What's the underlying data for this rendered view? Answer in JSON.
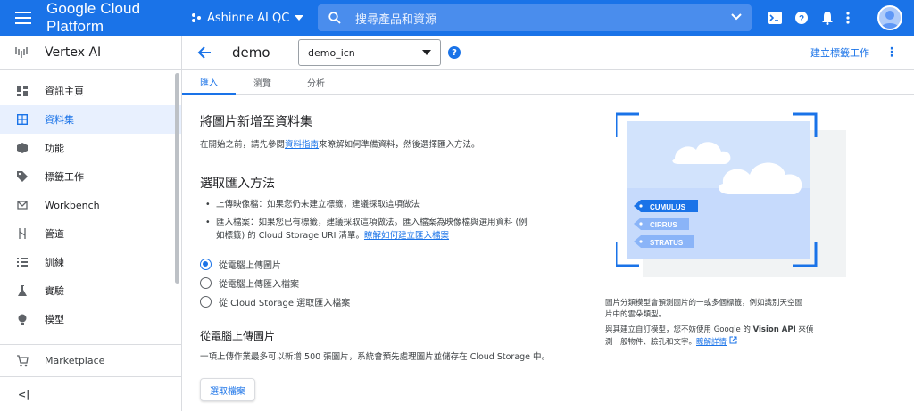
{
  "topbar": {
    "brand": "Google Cloud Platform",
    "project": "Ashinne AI QC",
    "search_placeholder": "搜尋產品和資源"
  },
  "side_header": {
    "title": "Vertex AI"
  },
  "breadcrumb": {
    "title": "demo",
    "select_value": "demo_icn",
    "create_label": "建立標籤工作"
  },
  "sidebar": {
    "items": [
      {
        "label": "資訊主頁",
        "icon": "dashboard-icon"
      },
      {
        "label": "資料集",
        "icon": "dataset-icon",
        "active": true
      },
      {
        "label": "功能",
        "icon": "features-icon"
      },
      {
        "label": "標籤工作",
        "icon": "label-icon"
      },
      {
        "label": "Workbench",
        "icon": "workbench-icon"
      },
      {
        "label": "管道",
        "icon": "pipelines-icon"
      },
      {
        "label": "訓練",
        "icon": "training-icon"
      },
      {
        "label": "實驗",
        "icon": "experiments-icon"
      },
      {
        "label": "模型",
        "icon": "models-icon"
      }
    ],
    "marketplace": "Marketplace",
    "collapse": "<|"
  },
  "tabs": [
    "匯入",
    "瀏覽",
    "分析"
  ],
  "main": {
    "heading": "將圖片新增至資料集",
    "intro_prefix": "在開始之前，請先參閱",
    "intro_link": "資料指南",
    "intro_suffix": "來瞭解如何準備資料，然後選擇匯入方法。",
    "method_heading": "選取匯入方法",
    "bullet1": "上傳映像檔：如果您仍未建立標籤，建議採取這項做法",
    "bullet2_line1": "匯入檔案：如果您已有標籤，建議採取這項做法。匯入檔案為映像檔與選用資料 (例",
    "bullet2_line2": "如標籤) 的 Cloud Storage URI 清單。",
    "bullet2_link": "瞭解如何建立匯入檔案",
    "radio1": "從電腦上傳圖片",
    "radio2": "從電腦上傳匯入檔案",
    "radio3": "從 Cloud Storage 選取匯入檔案",
    "upload_heading": "從電腦上傳圖片",
    "upload_text": "一項上傳作業最多可以新增 500 張圖片，系統會預先處理圖片並儲存在 Cloud Storage 中。",
    "select_button": "選取檔案"
  },
  "illustration": {
    "tags": [
      "CUMULUS",
      "CIRRUS",
      "STRATUS"
    ]
  },
  "description": {
    "line1": "圖片分類模型會預測圖片的一或多個標籤，例如識別天空圖",
    "line2": "片中的雲朵類型。",
    "line3_prefix": "與其建立自訂模型，您不妨使用 Google 的 ",
    "line3_bold": "Vision API",
    "line3_suffix": " 來偵",
    "line4_prefix": "測一般物件、臉孔和文字。",
    "line4_link": "瞭解詳情"
  },
  "colors": {
    "primary": "#1a73e8",
    "topbar": "#1a73e8",
    "active_bg": "#e8f0fe"
  }
}
